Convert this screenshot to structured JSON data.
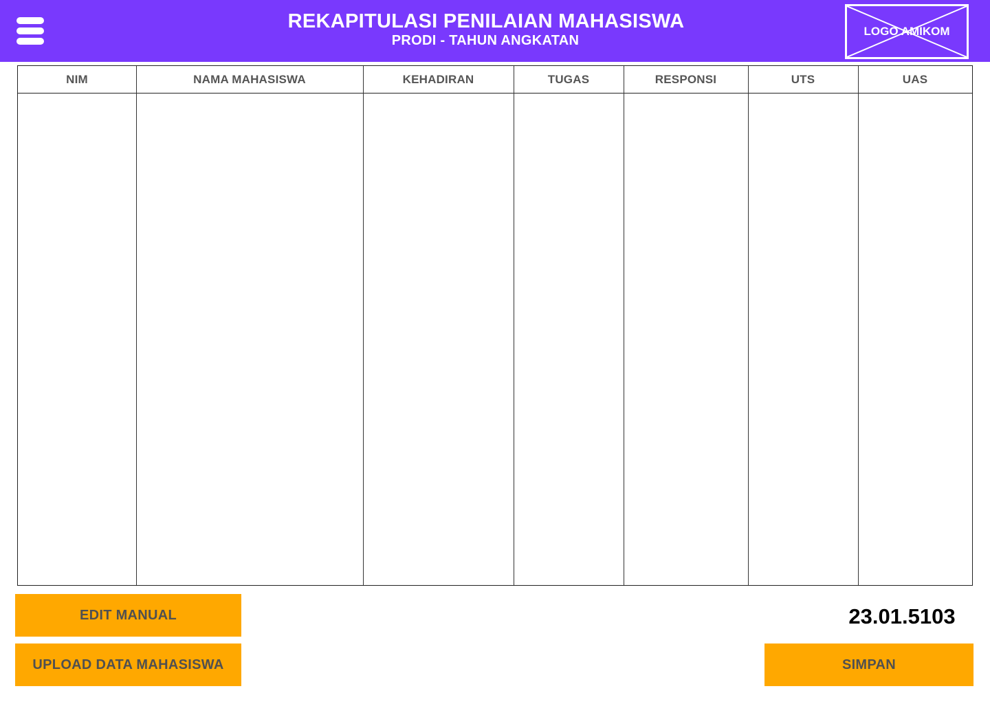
{
  "header": {
    "title": "REKAPITULASI PENILAIAN MAHASISWA",
    "subtitle": "PRODI - TAHUN ANGKATAN",
    "logo_text": "LOGO AMIKOM",
    "menu_icon": "hamburger-menu-icon",
    "background_color": "#7939fd"
  },
  "table": {
    "columns": [
      "NIM",
      "NAMA MAHASISWA",
      "KEHADIRAN",
      "TUGAS",
      "RESPONSI",
      "UTS",
      "UAS"
    ],
    "rows": []
  },
  "actions": {
    "edit_label": "EDIT MANUAL",
    "upload_label": "UPLOAD DATA MAHASISWA",
    "save_label": "SIMPAN",
    "button_color": "#ffa800"
  },
  "user": {
    "id": "23.01.5103"
  }
}
